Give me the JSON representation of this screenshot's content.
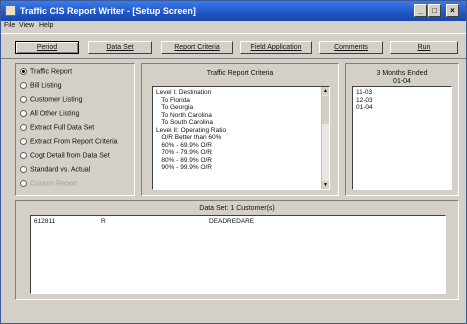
{
  "window": {
    "title": "Traffic CIS Report Writer - [Setup Screen]"
  },
  "menu": [
    "File",
    "View",
    "Help"
  ],
  "toolbar": [
    "Period",
    "Data Set",
    "Report Criteria",
    "Field Application",
    "Comments",
    "Run"
  ],
  "report_types": {
    "items": [
      "Traffic Report",
      "Bill Listing",
      "Customer Listing",
      "All Other Listing",
      "Extract Full Data Set",
      "Extract From Report Criteria",
      "Cogt Detail from Data Set",
      "Standard vs. Actual",
      "Custom Report"
    ],
    "selected_index": 0,
    "disabled_index": 8
  },
  "criteria": {
    "label": "Traffic Report Criteria",
    "lines": [
      "Level I: Destination",
      "   To Florida",
      "   To Georgia",
      "   To North Carolina",
      "   To South Carolina",
      "Level II: Operating Ratio",
      "   O/R Better than 60%",
      "   60% - 69.9% O/R",
      "   70% - 79.9% O/R",
      "   80% - 89.9% O/R",
      "   90% - 99.9% O/R"
    ]
  },
  "months": {
    "label": "3 Months Ended",
    "sublabel": "01-04",
    "items": [
      "11-03",
      "12-03",
      "01-04"
    ]
  },
  "dataset": {
    "label": "Data Set:  1 Customer(s)",
    "row": {
      "id": "612811",
      "code": "R",
      "name": "DEADREDARE"
    }
  },
  "icons": {
    "minimize": "minimize-icon",
    "maximize": "maximize-icon",
    "close": "close-icon"
  }
}
